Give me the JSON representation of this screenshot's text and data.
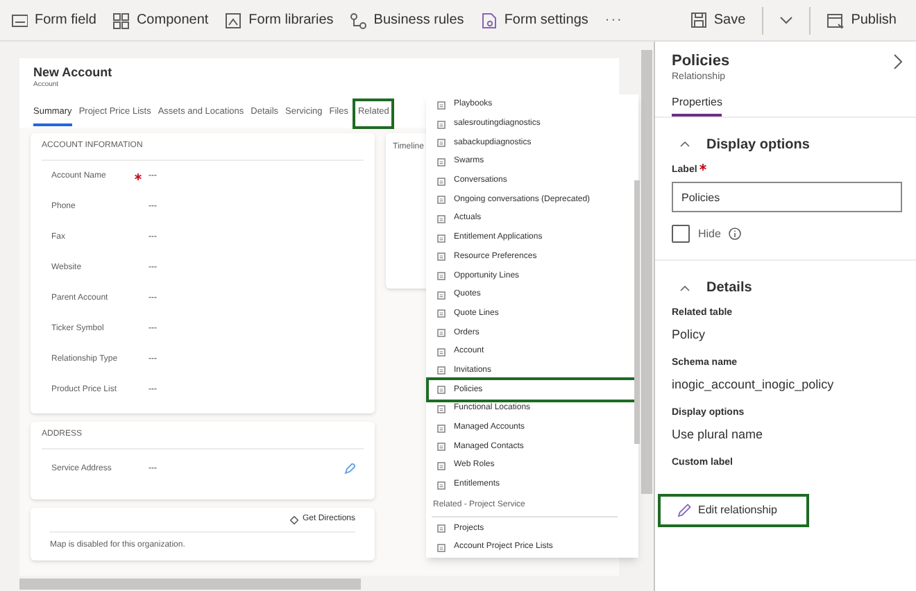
{
  "toolbar": {
    "items": [
      {
        "label": "Form field",
        "kind": "field"
      },
      {
        "label": "Component",
        "kind": "component"
      },
      {
        "label": "Form libraries",
        "kind": "library"
      },
      {
        "label": "Business rules",
        "kind": "rules"
      },
      {
        "label": "Form settings",
        "kind": "settings"
      }
    ],
    "more": "···",
    "save": "Save",
    "publish": "Publish"
  },
  "form": {
    "title": "New Account",
    "subtitle": "Account",
    "tabs": [
      {
        "label": "Summary",
        "selected": true,
        "highlighted": false
      },
      {
        "label": "Project Price Lists",
        "selected": false,
        "highlighted": false
      },
      {
        "label": "Assets and Locations",
        "selected": false,
        "highlighted": false
      },
      {
        "label": "Details",
        "selected": false,
        "highlighted": false
      },
      {
        "label": "Servicing",
        "selected": false,
        "highlighted": false
      },
      {
        "label": "Files",
        "selected": false,
        "highlighted": false
      },
      {
        "label": "Related",
        "selected": false,
        "highlighted": true
      }
    ],
    "account_section": {
      "title": "ACCOUNT INFORMATION",
      "fields": [
        {
          "label": "Account Name",
          "value": "---",
          "required": true
        },
        {
          "label": "Phone",
          "value": "---",
          "required": false
        },
        {
          "label": "Fax",
          "value": "---",
          "required": false
        },
        {
          "label": "Website",
          "value": "---",
          "required": false
        },
        {
          "label": "Parent Account",
          "value": "---",
          "required": false
        },
        {
          "label": "Ticker Symbol",
          "value": "---",
          "required": false
        },
        {
          "label": "Relationship Type",
          "value": "---",
          "required": false
        },
        {
          "label": "Product Price List",
          "value": "---",
          "required": false
        }
      ]
    },
    "timeline": {
      "title": "Timeline"
    },
    "address_section": {
      "title": "ADDRESS",
      "fields": [
        {
          "label": "Service Address",
          "value": "---"
        }
      ]
    },
    "map": {
      "action": "Get Directions",
      "message": "Map is disabled for this organization."
    }
  },
  "related_menu": {
    "items": [
      {
        "kind": "item",
        "label": "Playbooks",
        "highlighted": false
      },
      {
        "kind": "item",
        "label": "salesroutingdiagnostics",
        "highlighted": false
      },
      {
        "kind": "item",
        "label": "sabackupdiagnostics",
        "highlighted": false
      },
      {
        "kind": "item",
        "label": "Swarms",
        "highlighted": false
      },
      {
        "kind": "item",
        "label": "Conversations",
        "highlighted": false
      },
      {
        "kind": "item",
        "label": "Ongoing conversations (Deprecated)",
        "highlighted": false
      },
      {
        "kind": "item",
        "label": "Actuals",
        "highlighted": false
      },
      {
        "kind": "item",
        "label": "Entitlement Applications",
        "highlighted": false
      },
      {
        "kind": "item",
        "label": "Resource Preferences",
        "highlighted": false
      },
      {
        "kind": "item",
        "label": "Opportunity Lines",
        "highlighted": false
      },
      {
        "kind": "item",
        "label": "Quotes",
        "highlighted": false
      },
      {
        "kind": "item",
        "label": "Quote Lines",
        "highlighted": false
      },
      {
        "kind": "item",
        "label": "Orders",
        "highlighted": false
      },
      {
        "kind": "item",
        "label": "Account",
        "highlighted": false
      },
      {
        "kind": "item",
        "label": "Invitations",
        "highlighted": false
      },
      {
        "kind": "item",
        "label": "Policies",
        "highlighted": true
      },
      {
        "kind": "item",
        "label": "Functional Locations",
        "highlighted": false
      },
      {
        "kind": "item",
        "label": "Managed Accounts",
        "highlighted": false
      },
      {
        "kind": "item",
        "label": "Managed Contacts",
        "highlighted": false
      },
      {
        "kind": "item",
        "label": "Web Roles",
        "highlighted": false
      },
      {
        "kind": "item",
        "label": "Entitlements",
        "highlighted": false
      },
      {
        "kind": "header",
        "label": "Related - Project Service"
      },
      {
        "kind": "item",
        "label": "Projects",
        "highlighted": false
      },
      {
        "kind": "item",
        "label": "Account Project Price Lists",
        "highlighted": false
      }
    ]
  },
  "panel": {
    "title": "Policies",
    "subtitle": "Relationship",
    "tabs": [
      {
        "label": "Properties",
        "selected": true
      }
    ],
    "display_options": {
      "title": "Display options",
      "expanded": true,
      "label_field": {
        "label": "Label",
        "required": true,
        "value": "Policies"
      },
      "hide": {
        "label": "Hide",
        "checked": false
      }
    },
    "details": {
      "title": "Details",
      "expanded": true,
      "properties": [
        {
          "label": "Related table",
          "value": "Policy"
        },
        {
          "label": "Schema name",
          "value": "inogic_account_inogic_policy"
        },
        {
          "label": "Display options",
          "value": "Use plural name"
        },
        {
          "label": "Custom label"
        }
      ]
    },
    "edit_button": {
      "label": "Edit relationship",
      "highlighted": true
    }
  }
}
